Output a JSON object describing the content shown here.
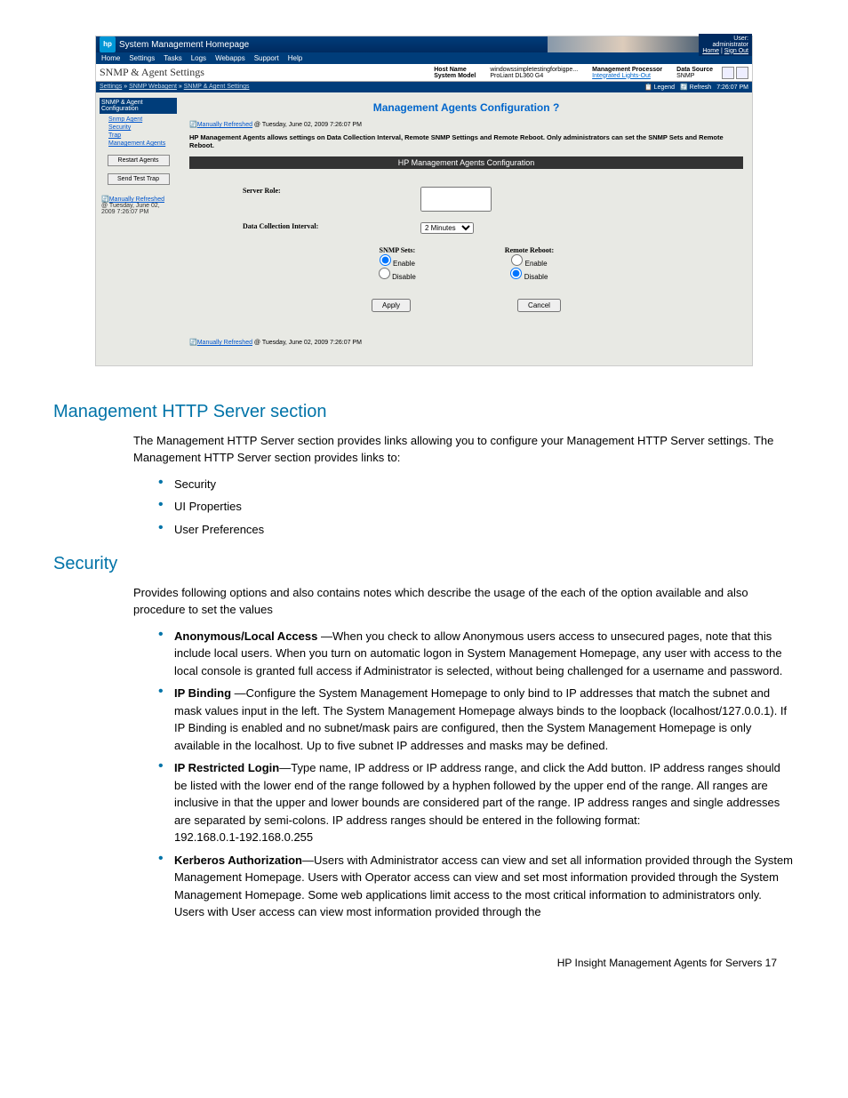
{
  "screenshot": {
    "appTitle": "System Management Homepage",
    "user": {
      "label": "User:",
      "name": "administrator",
      "homeLink": "Home",
      "signOut": "Sign Out"
    },
    "menubar": [
      "Home",
      "Settings",
      "Tasks",
      "Logs",
      "Webapps",
      "Support",
      "Help"
    ],
    "sectionTitle": "SNMP & Agent Settings",
    "infoCols": {
      "hostNameLabel": "Host Name",
      "hostNameVal": "windowssimpletestingforbigpe...",
      "sysModelLabel": "System Model",
      "sysModelVal": "ProLiant DL360 G4",
      "mgmtProcLabel": "Management Processor",
      "mgmtProcVal": "Integrated Lights-Out",
      "dataSrcLabel": "Data Source",
      "dataSrcVal": "SNMP"
    },
    "breadcrumb": {
      "a": "Settings",
      "b": "SNMP Webagent",
      "c": "SNMP & Agent Settings"
    },
    "crumbRight": {
      "legend": "Legend",
      "refresh": "Refresh",
      "time": "7:26:07 PM"
    },
    "sidebar": {
      "header": "SNMP & Agent Configuration",
      "items": [
        "Snmp Agent",
        "Security",
        "Trap",
        "Management Agents"
      ],
      "btnRestart": "Restart Agents",
      "btnSendTrap": "Send Test Trap",
      "tsLink": "Manually Refreshed",
      "tsText": "@ Tuesday, June 02, 2009 7:26:07 PM"
    },
    "main": {
      "title": "Management Agents Configuration",
      "helpIcon": "?",
      "refLine": {
        "link": "Manually Refreshed",
        "text": " @ Tuesday, June 02, 2009 7:26:07 PM"
      },
      "desc": "HP Management Agents allows settings on Data Collection Interval, Remote SNMP Settings and Remote Reboot. Only administrators can set the SNMP Sets and Remote Reboot.",
      "darkbar": "HP Management Agents Configuration",
      "serverRoleLabel": "Server Role:",
      "dataIntervalLabel": "Data Collection Interval:",
      "dataIntervalVal": "2 Minutes",
      "snmpSetsLabel": "SNMP Sets:",
      "remoteRebootLabel": "Remote Reboot:",
      "enable": "Enable",
      "disable": "Disable",
      "applyBtn": "Apply",
      "cancelBtn": "Cancel",
      "refLine2": {
        "link": "Manually Refreshed",
        "text": " @ Tuesday, June 02, 2009 7:26:07 PM"
      }
    }
  },
  "doc": {
    "h2a": "Management HTTP Server section",
    "p1": "The Management HTTP Server section provides links allowing you to configure your Management HTTP Server settings. The Management HTTP Server section provides links to:",
    "list1": [
      "Security",
      "UI Properties",
      "User Preferences"
    ],
    "h2b": "Security",
    "p2": "Provides following options and also contains notes which describe the usage of the each of the option available and also procedure to set the values",
    "list2": [
      {
        "b": "Anonymous/Local Access",
        "t": " —When you check to allow Anonymous users access to unsecured pages, note that this include local users.  When you turn on automatic logon in System Management Homepage, any user with access to the local console is granted full access if Administrator is selected, without being challenged for a username and password."
      },
      {
        "b": "IP Binding",
        "t": " —Configure the System Management Homepage to only bind to IP addresses that match the subnet and mask values input in the left. The System Management Homepage always binds to the loopback (localhost/127.0.0.1). If IP Binding is enabled and no subnet/mask pairs are configured, then the System Management Homepage is only available in the localhost.  Up to five subnet IP addresses and masks may be defined."
      },
      {
        "b": "IP Restricted Login",
        "t": "—Type name, IP address or IP address range, and click the Add button. IP address ranges should be listed with the lower end of the range followed by a hyphen followed by the upper end of the range. All ranges are inclusive in that the upper and lower bounds are considered part of the range. IP address ranges and single addresses are separated by semi-colons. IP address ranges should be entered in the following format:\n192.168.0.1-192.168.0.255"
      },
      {
        "b": "Kerberos Authorization",
        "t": "—Users with Administrator access can view and set all information provided through the System Management Homepage. Users with Operator access can view and set most information provided through the System Management Homepage. Some web applications limit access to the most critical information to administrators only. Users with User access can view most information provided through the"
      }
    ],
    "footer": "HP Insight Management Agents for Servers   17"
  }
}
